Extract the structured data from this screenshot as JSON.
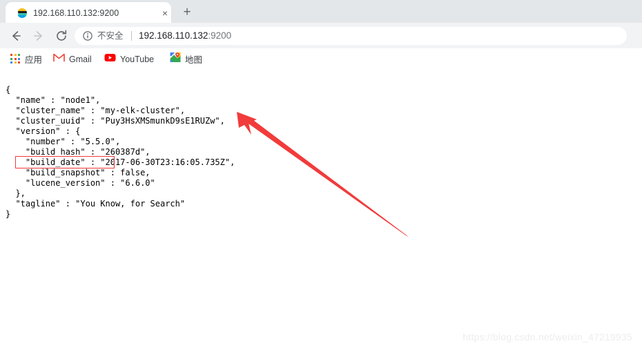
{
  "browser": {
    "tab": {
      "title": "192.168.110.132:9200",
      "favicon": "elasticsearch-favicon",
      "close_label": "×"
    },
    "new_tab_label": "+",
    "toolbar": {
      "back_icon": "arrow-left-icon",
      "forward_icon": "arrow-right-icon",
      "reload_icon": "reload-icon",
      "back_enabled": "true",
      "forward_enabled": "false"
    },
    "omnibox": {
      "info_icon": "info-circle-icon",
      "security_text": "不安全",
      "url_host": "192.168.110.132",
      "url_port": ":9200",
      "full_url": "192.168.110.132:9200"
    },
    "bookmarks": [
      {
        "label": "应用",
        "icon": "apps-grid-icon"
      },
      {
        "label": "Gmail",
        "icon": "gmail-icon"
      },
      {
        "label": "YouTube",
        "icon": "youtube-icon"
      },
      {
        "label": "地图",
        "icon": "google-maps-icon"
      }
    ]
  },
  "page": {
    "content_type": "json",
    "json_lines": [
      "{",
      "  \"name\" : \"node1\",",
      "  \"cluster_name\" : \"my-elk-cluster\",",
      "  \"cluster_uuid\" : \"Puy3HsXMSmunkD9sE1RUZw\",",
      "  \"version\" : {",
      "    \"number\" : \"5.5.0\",",
      "    \"build_hash\" : \"260387d\",",
      "    \"build_date\" : \"2017-06-30T23:16:05.735Z\",",
      "    \"build_snapshot\" : false,",
      "    \"lucene_version\" : \"6.6.0\"",
      "  },",
      "  \"tagline\" : \"You Know, for Search\"",
      "}"
    ],
    "json_values": {
      "name": "node1",
      "cluster_name": "my-elk-cluster",
      "cluster_uuid": "Puy3HsXMSmunkD9sE1RUZw",
      "version_number": "5.5.0",
      "build_hash": "260387d",
      "build_date": "2017-06-30T23:16:05.735Z",
      "build_snapshot": "false",
      "lucene_version": "6.6.0",
      "tagline": "You Know, for Search"
    }
  },
  "annotations": {
    "highlight_target": "\"name\" : \"node1\",",
    "arrow_color": "#f23b3b",
    "highlight_color": "#f03a3a"
  },
  "watermark": {
    "text": "https://blog.csdn.net/weixin_47219935"
  }
}
